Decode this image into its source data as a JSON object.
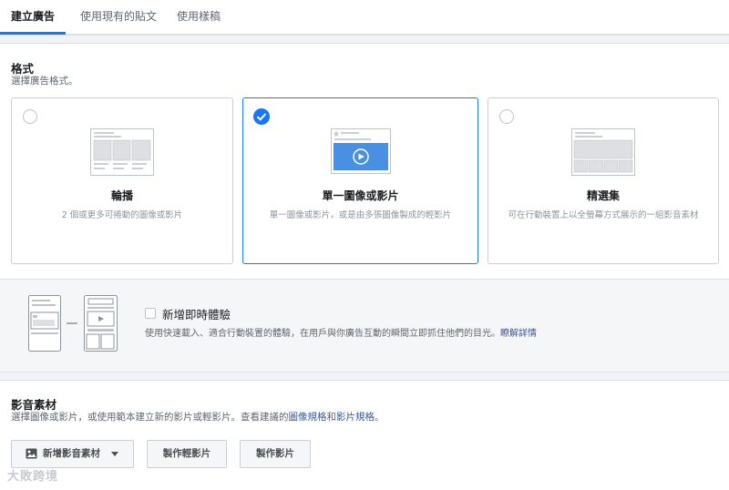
{
  "tabs": [
    {
      "label": "建立廣告",
      "active": true
    },
    {
      "label": "使用現有的貼文",
      "active": false
    },
    {
      "label": "使用樣稿",
      "active": false
    }
  ],
  "format": {
    "title": "格式",
    "subtitle": "選擇廣告格式。",
    "cards": [
      {
        "title": "輪播",
        "desc": "2 個或更多可捲動的圖像或影片",
        "selected": false
      },
      {
        "title": "單一圖像或影片",
        "desc": "單一圖像或影片，或是由多張圖像製成的輕影片",
        "selected": true
      },
      {
        "title": "精選集",
        "desc": "可在行動裝置上以全螢幕方式展示的一組影音素材",
        "selected": false
      }
    ]
  },
  "instant_experience": {
    "title": "新增即時體驗",
    "desc": "使用快速載入、適合行動裝置的體驗，在用戶與你廣告互動的瞬間立即抓住他們的目光。",
    "link": "瞭解詳情",
    "checked": false
  },
  "media": {
    "title": "影音素材",
    "subtitle_pre": "選擇圖像或影片，或使用範本建立新的影片或輕影片。查看建議的",
    "link1": "圖像規格",
    "and": "和",
    "link2": "影片規格",
    "subtitle_post": "。",
    "buttons": {
      "add_media": "新增影音素材",
      "make_slideshow": "製作輕影片",
      "make_video": "製作影片"
    }
  },
  "watermark": "大敗跨境",
  "colors": {
    "accent": "#1877f2",
    "link": "#385898",
    "border": "#ccd0d5",
    "bg_gray": "#f5f6f7"
  },
  "icons": [
    "check-icon",
    "image-icon",
    "caret-down-icon",
    "play-icon"
  ]
}
